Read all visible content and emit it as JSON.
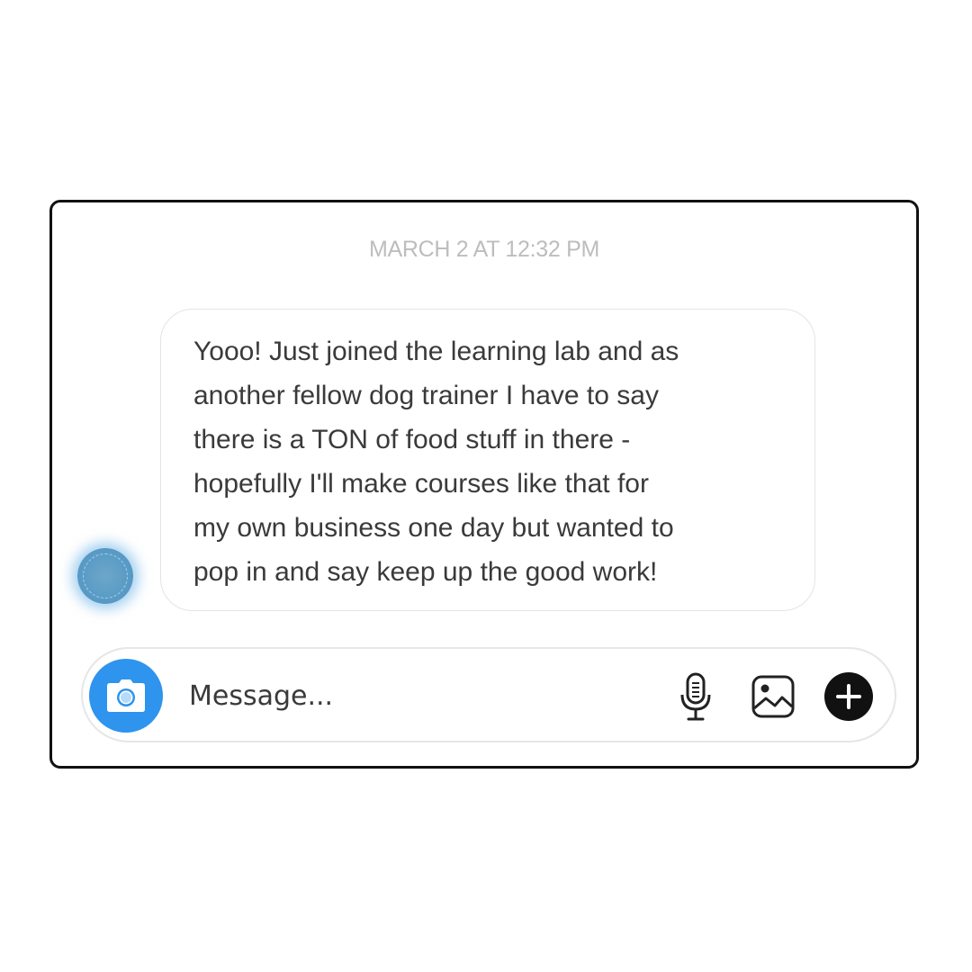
{
  "conversation": {
    "timestamp": "MARCH 2 AT 12:32 PM",
    "message": {
      "lines": [
        "Yooo! Just joined the learning lab and as",
        "another fellow dog trainer I have to say",
        "there is a TON of food stuff in there -",
        "hopefully I'll make courses like that for",
        "my own business one day but wanted to",
        "pop in and say keep up the good work!"
      ]
    }
  },
  "composer": {
    "placeholder": "Message...",
    "value": "",
    "icons": {
      "camera": "camera-icon",
      "mic": "microphone-icon",
      "image": "image-icon",
      "plus": "plus-icon"
    }
  },
  "colors": {
    "accent": "#2e94ee",
    "timestamp": "#bdbdbd",
    "text": "#3a3a3a",
    "frame_border": "#111111",
    "avatar_glow": "#5aaae6"
  }
}
